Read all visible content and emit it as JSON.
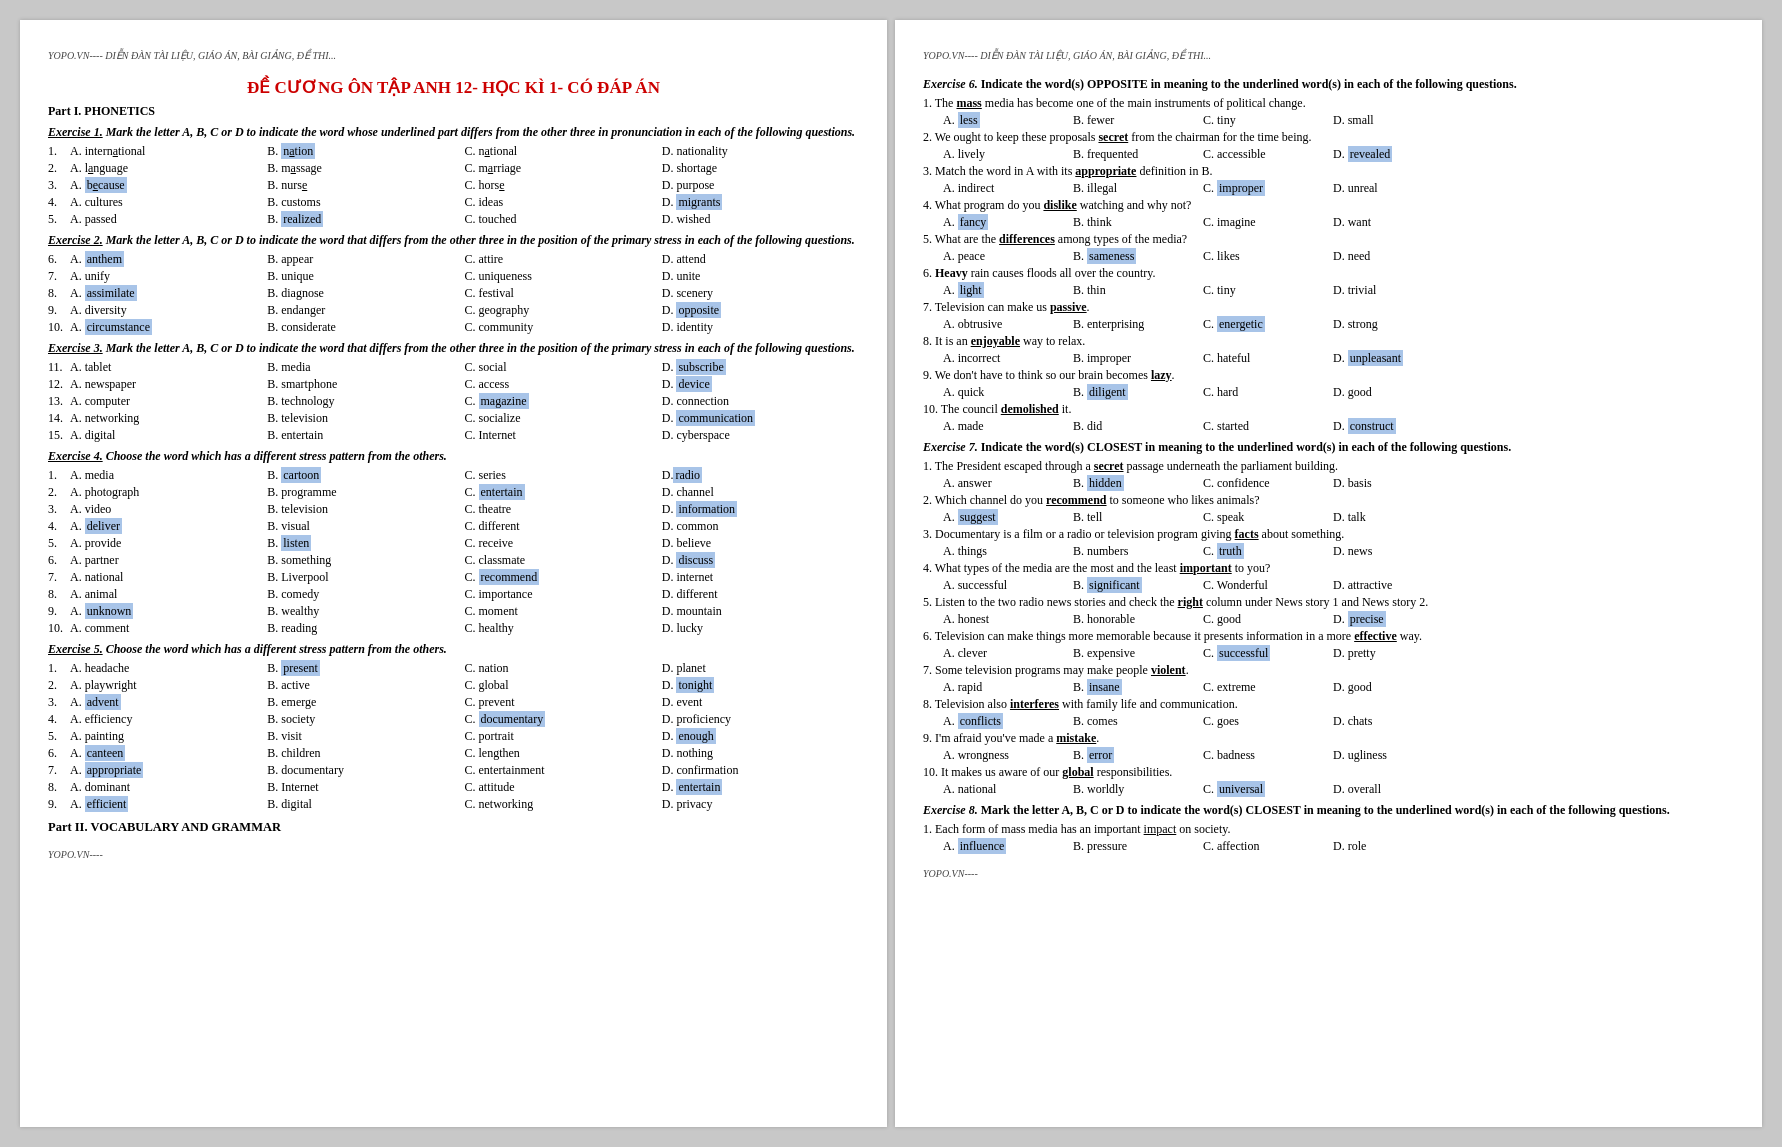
{
  "left_page": {
    "watermark": "YOPO.VN---- DIỄN ĐÀN TÀI LIỆU, GIÁO ÁN, BÀI GIẢNG, ĐỀ THI...",
    "title": "ĐỀ CƯƠNG ÔN TẬP ANH 12- HỌC KÌ 1- CÓ ĐÁP ÁN",
    "part1": "Part I. PHONETICS",
    "ex1_title": "Exercise 1. Mark the letter A, B, C or D to indicate the word whose underlined part differs from the other three in pronunciation in each of the following questions.",
    "ex2_title": "Exercise 2. Mark the letter A, B, C or D to indicate the word that differs from the other three in the position of the primary stress in each of the following questions.",
    "ex3_title": "Exercise 3. Mark the letter A, B, C or D to indicate the word that differs from the other three in the position of the primary stress in each of the following questions.",
    "ex4_title": "Exercise 4.  Choose the word which has a different stress pattern from the others.",
    "ex5_title": "Exercise 5. Choose the word which has a different stress pattern from the others.",
    "part2": "Part II. VOCABULARY AND GRAMMAR",
    "footer": "YOPO.VN----"
  },
  "right_page": {
    "watermark": "YOPO.VN---- DIỄN ĐÀN TÀI LIỆU, GIÁO ÁN, BÀI GIẢNG, ĐỀ THI...",
    "footer": "YOPO.VN----"
  }
}
